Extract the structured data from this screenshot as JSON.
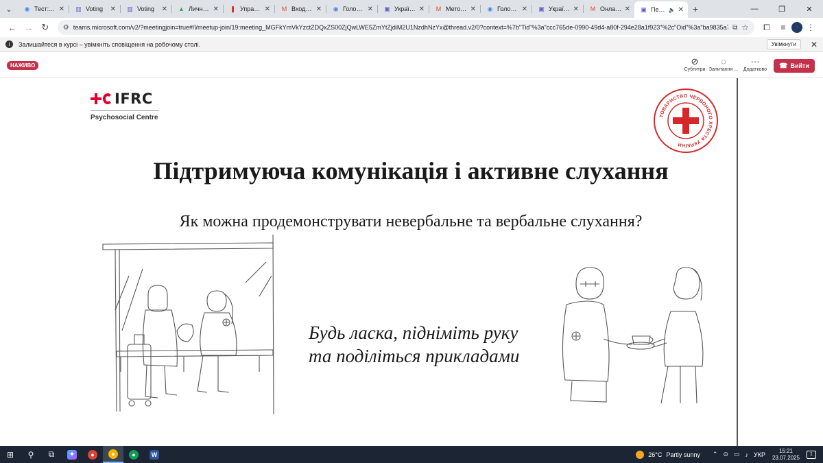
{
  "browser": {
    "tabs": [
      {
        "title": "Тест: Дра",
        "icon": "circle-icon",
        "icon_color": "#4285f4"
      },
      {
        "title": "Voting",
        "icon": "chart-icon",
        "icon_color": "#5b5fc7"
      },
      {
        "title": "Voting",
        "icon": "chart-icon",
        "icon_color": "#5b5fc7"
      },
      {
        "title": "Личный",
        "icon": "drive-icon",
        "icon_color": "#34a853"
      },
      {
        "title": "Управлен",
        "icon": "bookmark-icon",
        "icon_color": "#d93025"
      },
      {
        "title": "Входящи",
        "icon": "gmail-icon",
        "icon_color": "#ea4335"
      },
      {
        "title": "Головна",
        "icon": "circle-icon",
        "icon_color": "#4285f4"
      },
      {
        "title": "Україна",
        "icon": "teams-icon",
        "icon_color": "#5b5fc7"
      },
      {
        "title": "Методол",
        "icon": "gmail-icon",
        "icon_color": "#ea4335"
      },
      {
        "title": "Головна",
        "icon": "circle-icon",
        "icon_color": "#4285f4"
      },
      {
        "title": "Україна",
        "icon": "teams-icon",
        "icon_color": "#5b5fc7"
      },
      {
        "title": "Онлайн-",
        "icon": "gmail-icon",
        "icon_color": "#ea4335"
      },
      {
        "title": "Перш",
        "icon": "teams-icon",
        "icon_color": "#5b5fc7",
        "active": true
      }
    ],
    "url": "teams.microsoft.com/v2/?meetingjoin=true#/l/meetup-join/19:meeting_MGFkYmVkYzctZDQxZS00ZjQwLWE5ZmYtZjdiM2U1NzdhNzYx@thread.v2/0?context=%7b\"Tid\"%3a\"ccc765de-0990-49d4-a80f-294e28a1f923\"%2c\"Oid\"%3a\"ba9835a7-d1f..."
  },
  "infobar": {
    "message": "Залишайтеся в курсі – увімкніть сповіщення на робочому столі.",
    "enable_label": "Увімкнути"
  },
  "meeting": {
    "live_label": "НАЖИВО",
    "controls": [
      {
        "label": "Субтитри",
        "icon": "captions-icon"
      },
      {
        "label": "Запитання ...",
        "icon": "qa-icon"
      },
      {
        "label": "Додатково",
        "icon": "more-icon"
      }
    ],
    "leave_label": "Вийти"
  },
  "slide": {
    "logo_text": "IFRC",
    "logo_subtitle": "Psychosocial Centre",
    "seal_text": "ТОВАРИСТВО ЧЕРВОНОГО ХРЕСТА УКРАЇНИ",
    "title": "Підтримуюча комунікація і активне слухання",
    "subtitle": "Як можна продемонструвати невербальне та вербальне слухання?",
    "call_to_action": "Будь ласка, підніміть руку та поділіться прикладами"
  },
  "taskbar": {
    "weather_temp": "26°C",
    "weather_text": "Partly sunny",
    "language": "УКР",
    "time": "15:21",
    "date": "23.07.2025"
  }
}
